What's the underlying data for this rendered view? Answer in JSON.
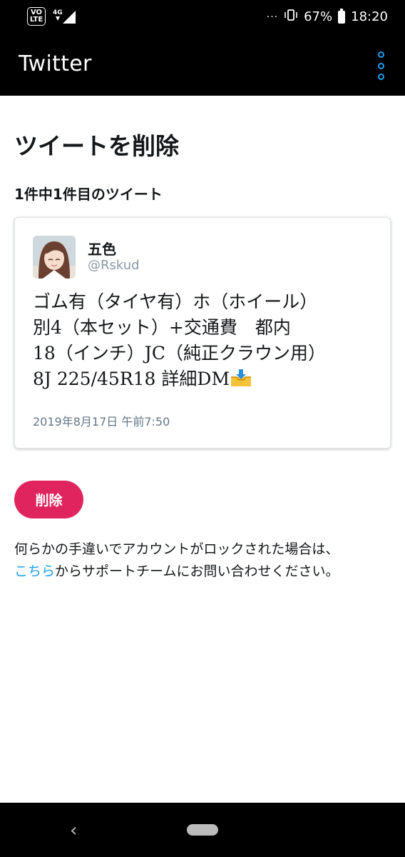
{
  "status_bar": {
    "volte": "VO LTE",
    "network": "4G",
    "more": "···",
    "battery": "67%",
    "time": "18:20"
  },
  "app_bar": {
    "title": "Twitter",
    "overflow_icon": "more-vertical-icon"
  },
  "page": {
    "title": "ツイートを削除",
    "subtitle": "1件中1件目のツイート"
  },
  "tweet": {
    "author_name": "五色",
    "author_handle": "@Rskud",
    "lines": [
      "ゴム有（タイヤ有）ホ（ホイール）",
      "別4（本セット）+交通費　都内",
      "18（インチ）JC（純正クラウン用）",
      "8J 225/45R18 詳細DM"
    ],
    "emoji": "inbox-tray-icon",
    "timestamp": "2019年8月17日 午前7:50"
  },
  "actions": {
    "delete_label": "削除"
  },
  "help": {
    "line1": "何らかの手違いでアカウントがロックされた場合は、",
    "link": "こちら",
    "line2_rest": "からサポートチームにお問い合わせください。"
  },
  "colors": {
    "accent": "#1da1f2",
    "delete": "#e0245e",
    "bars": "#000000"
  }
}
